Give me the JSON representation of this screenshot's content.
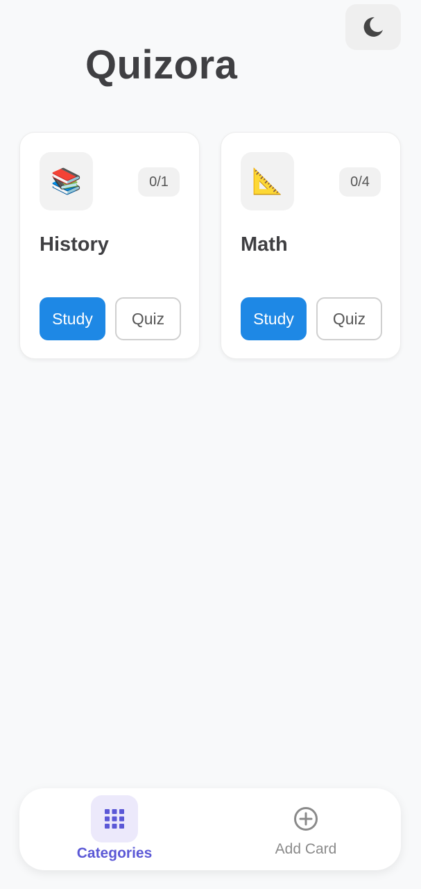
{
  "app": {
    "title": "Quizora"
  },
  "theme_toggle": {
    "icon": "moon-icon"
  },
  "categories": [
    {
      "name": "History",
      "icon": "books-icon",
      "progress": "0/1",
      "study_label": "Study",
      "quiz_label": "Quiz"
    },
    {
      "name": "Math",
      "icon": "triangular-ruler-icon",
      "progress": "0/4",
      "study_label": "Study",
      "quiz_label": "Quiz"
    }
  ],
  "bottom_nav": {
    "items": [
      {
        "label": "Categories",
        "icon": "grid-icon",
        "active": true
      },
      {
        "label": "Add Card",
        "icon": "add-circle-icon",
        "active": false
      }
    ]
  },
  "colors": {
    "accent": "#1e88e5",
    "nav_active": "#5b58d6",
    "background": "#f8f9fa"
  }
}
